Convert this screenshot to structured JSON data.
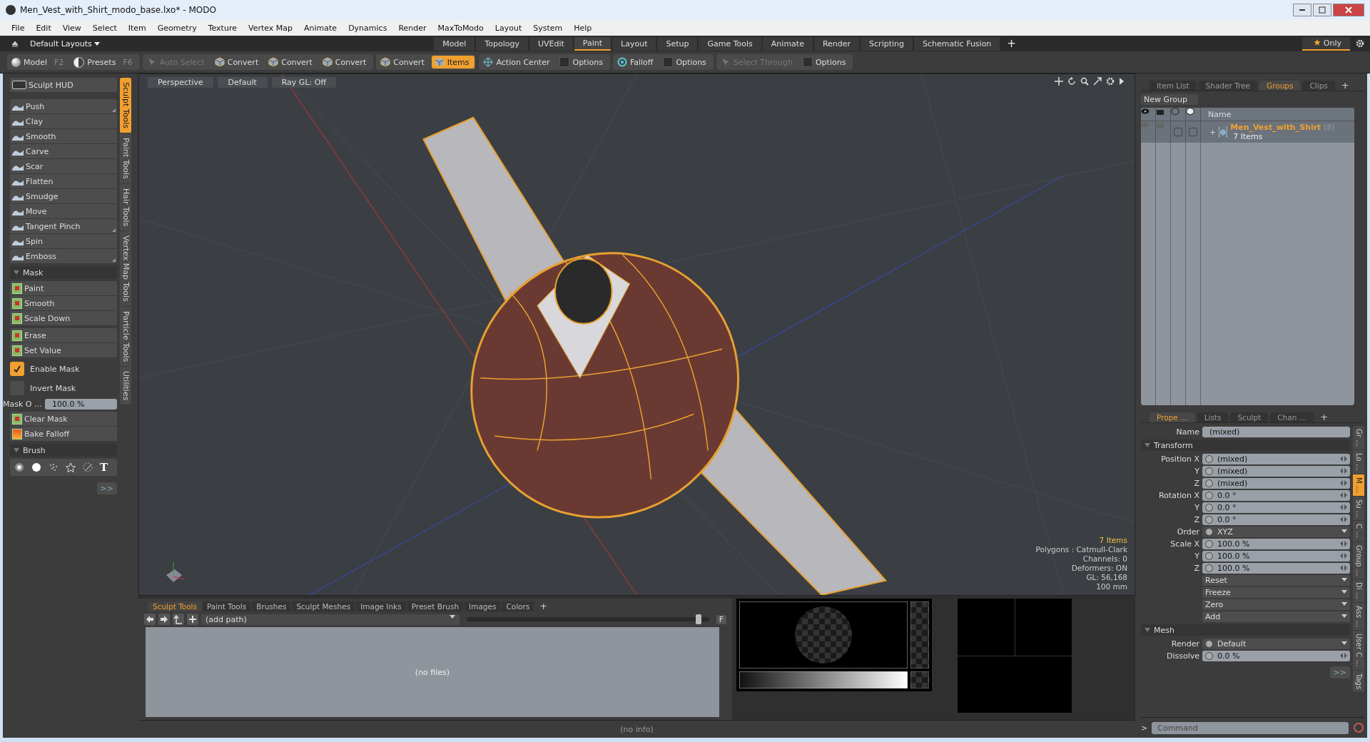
{
  "window": {
    "title": "Men_Vest_with_Shirt_modo_base.lxo* - MODO"
  },
  "menu": [
    "File",
    "Edit",
    "View",
    "Select",
    "Item",
    "Geometry",
    "Texture",
    "Vertex Map",
    "Animate",
    "Dynamics",
    "Render",
    "MaxToModo",
    "Layout",
    "System",
    "Help"
  ],
  "layouts_bar": {
    "layout_menu": "Default Layouts",
    "add": "+",
    "only_button": "Only",
    "tabs": [
      {
        "label": "Model",
        "selected": false
      },
      {
        "label": "Topology",
        "selected": false
      },
      {
        "label": "UVEdit",
        "selected": false
      },
      {
        "label": "Paint",
        "selected": true
      },
      {
        "label": "Layout",
        "selected": false
      },
      {
        "label": "Setup",
        "selected": false
      },
      {
        "label": "Game Tools",
        "selected": false
      },
      {
        "label": "Animate",
        "selected": false
      },
      {
        "label": "Render",
        "selected": false
      },
      {
        "label": "Scripting",
        "selected": false
      },
      {
        "label": "Schematic Fusion",
        "selected": false
      }
    ]
  },
  "toolbar": {
    "modes": [
      {
        "label": "Model",
        "key": "F2",
        "kind": "sphere"
      },
      {
        "label": "Presets",
        "key": "F6",
        "kind": "half"
      }
    ],
    "tool_groups": [
      [
        {
          "label": "Auto Select",
          "kind": "select",
          "selected": false,
          "disabled": true
        },
        {
          "label": "Convert",
          "kind": "cube",
          "selected": false,
          "disabled": false
        },
        {
          "label": "Convert",
          "kind": "cube",
          "selected": false,
          "disabled": false
        },
        {
          "label": "Convert",
          "kind": "cube",
          "selected": false,
          "disabled": false
        }
      ],
      [
        {
          "label": "Convert",
          "kind": "cube",
          "selected": false,
          "disabled": false
        },
        {
          "label": "Items",
          "kind": "cube",
          "selected": true,
          "disabled": false
        }
      ],
      [
        {
          "label": "Action Center",
          "kind": "target",
          "selected": false,
          "disabled": false
        },
        {
          "label": "Options",
          "kind": "check",
          "selected": false,
          "disabled": false,
          "checked": false
        }
      ],
      [
        {
          "label": "Falloff",
          "kind": "ring",
          "selected": false,
          "disabled": false
        },
        {
          "label": "Options",
          "kind": "check",
          "selected": false,
          "disabled": false,
          "checked": false
        }
      ],
      [
        {
          "label": "Select Through",
          "kind": "select",
          "selected": false,
          "disabled": true
        },
        {
          "label": "Options",
          "kind": "check",
          "selected": false,
          "disabled": false,
          "checked": false
        }
      ]
    ]
  },
  "left_panel": {
    "hud_button": "Sculpt HUD",
    "vertical_tabs": [
      {
        "label": "Sculpt Tools",
        "selected": true
      },
      {
        "label": "Paint Tools",
        "selected": false
      },
      {
        "label": "Hair Tools",
        "selected": false
      },
      {
        "label": "Vertex Map Tools",
        "selected": false
      },
      {
        "label": "Particle Tools",
        "selected": false
      },
      {
        "label": "Utilities",
        "selected": false
      }
    ],
    "sculpt_tools": [
      {
        "label": "Push",
        "submenu": true
      },
      {
        "label": "Clay",
        "submenu": false
      },
      {
        "label": "Smooth",
        "submenu": false
      },
      {
        "label": "Carve",
        "submenu": false
      },
      {
        "label": "Scar",
        "submenu": false
      },
      {
        "label": "Flatten",
        "submenu": false
      },
      {
        "label": "Smudge",
        "submenu": false
      },
      {
        "label": "Move",
        "submenu": false
      },
      {
        "label": "Tangent Pinch",
        "submenu": true
      },
      {
        "label": "Spin",
        "submenu": false
      },
      {
        "label": "Emboss",
        "submenu": true
      }
    ],
    "mask": {
      "title": "Mask",
      "expanded": true,
      "tools": [
        "Paint",
        "Smooth",
        "Scale Down"
      ],
      "tools_2": [
        "Erase",
        "Set Value"
      ]
    },
    "enable_mask": {
      "label": "Enable Mask",
      "checked": true
    },
    "invert_mask": {
      "label": "Invert Mask",
      "checked": false
    },
    "mask_opacity": {
      "label": "Mask O …",
      "value": "100.0 %"
    },
    "mask_tools_3": [
      "Clear Mask",
      "Bake Falloff"
    ],
    "brush": {
      "title": "Brush",
      "expanded": true,
      "text_tool": "T"
    },
    "more": ">>"
  },
  "viewport": {
    "header": [
      "Perspective",
      "Default",
      "Ray GL: Off"
    ],
    "items": "7 Items",
    "info": [
      "Polygons : Catmull-Clark",
      "Channels: 0",
      "Deformers: ON",
      "GL: 56,168",
      "100 mm"
    ]
  },
  "bottom_panel": {
    "tabs": [
      {
        "label": "Sculpt Tools",
        "selected": true
      },
      {
        "label": "Paint Tools",
        "selected": false
      },
      {
        "label": "Brushes",
        "selected": false
      },
      {
        "label": "Sculpt Meshes",
        "selected": false
      },
      {
        "label": "Image Inks",
        "selected": false
      },
      {
        "label": "Preset Brush",
        "selected": false
      },
      {
        "label": "Images",
        "selected": false
      },
      {
        "label": "Colors",
        "selected": false
      }
    ],
    "add": "+",
    "path_field": "(add path)",
    "thumbnail_size": {
      "level": 0.97
    },
    "empty_text": "(no files)",
    "filter_button": "F"
  },
  "status_bar": {
    "text": "(no info)"
  },
  "right_panel": {
    "tabs": [
      {
        "label": "Item List",
        "selected": false
      },
      {
        "label": "Shader Tree",
        "selected": false
      },
      {
        "label": "Groups",
        "selected": true
      },
      {
        "label": "Clips",
        "selected": false
      }
    ],
    "add": "+",
    "new_group": "New Group",
    "name_column": "Name",
    "groups": [
      {
        "name": "Men_Vest_with_Shirt",
        "count": "(8)",
        "summary": "7 Items",
        "expand": "+",
        "render_checked": false,
        "lock_checked": false
      }
    ]
  },
  "properties": {
    "tabs": [
      {
        "label": "Prope …",
        "selected": true
      },
      {
        "label": "Lists",
        "selected": false
      },
      {
        "label": "Sculpt",
        "selected": false
      },
      {
        "label": "Chan …",
        "selected": false
      }
    ],
    "add": "+",
    "rows": [
      {
        "kind": "text",
        "label": "Name",
        "value": "(mixed)"
      },
      {
        "kind": "section",
        "label": "Transform",
        "expanded": true
      },
      {
        "kind": "number",
        "label": "Position X",
        "value": "(mixed)"
      },
      {
        "kind": "number",
        "label": "Y",
        "value": "(mixed)"
      },
      {
        "kind": "number",
        "label": "Z",
        "value": "(mixed)"
      },
      {
        "kind": "number",
        "label": "Rotation X",
        "value": "0.0 °"
      },
      {
        "kind": "number",
        "label": "Y",
        "value": "0.0 °"
      },
      {
        "kind": "number",
        "label": "Z",
        "value": "0.0 °"
      },
      {
        "kind": "dropdown",
        "label": "Order",
        "value": "XYZ"
      },
      {
        "kind": "number",
        "label": "Scale X",
        "value": "100.0 %"
      },
      {
        "kind": "number",
        "label": "Y",
        "value": "100.0 %"
      },
      {
        "kind": "number",
        "label": "Z",
        "value": "100.0 %"
      },
      {
        "kind": "action",
        "value": "Reset"
      },
      {
        "kind": "action",
        "value": "Freeze"
      },
      {
        "kind": "action",
        "value": "Zero"
      },
      {
        "kind": "action",
        "value": "Add"
      },
      {
        "kind": "section",
        "label": "Mesh",
        "expanded": true
      },
      {
        "kind": "dropdown",
        "label": "Render",
        "value": "Default"
      },
      {
        "kind": "number",
        "label": "Dissolve",
        "value": "0.0 %"
      }
    ],
    "more": ">>",
    "side_tabs": [
      {
        "label": "Gr …",
        "selected": false
      },
      {
        "label": "Lo …",
        "selected": false
      },
      {
        "label": "M …",
        "selected": true
      },
      {
        "label": "Su …",
        "selected": false
      },
      {
        "label": "C …",
        "selected": false
      },
      {
        "label": "Group …",
        "selected": false
      },
      {
        "label": "Di …",
        "selected": false
      },
      {
        "label": "Ass …",
        "selected": false
      },
      {
        "label": "User C …",
        "selected": false
      },
      {
        "label": "Tags",
        "selected": false
      }
    ],
    "prompt": ">",
    "command": {
      "placeholder": "Command"
    }
  }
}
